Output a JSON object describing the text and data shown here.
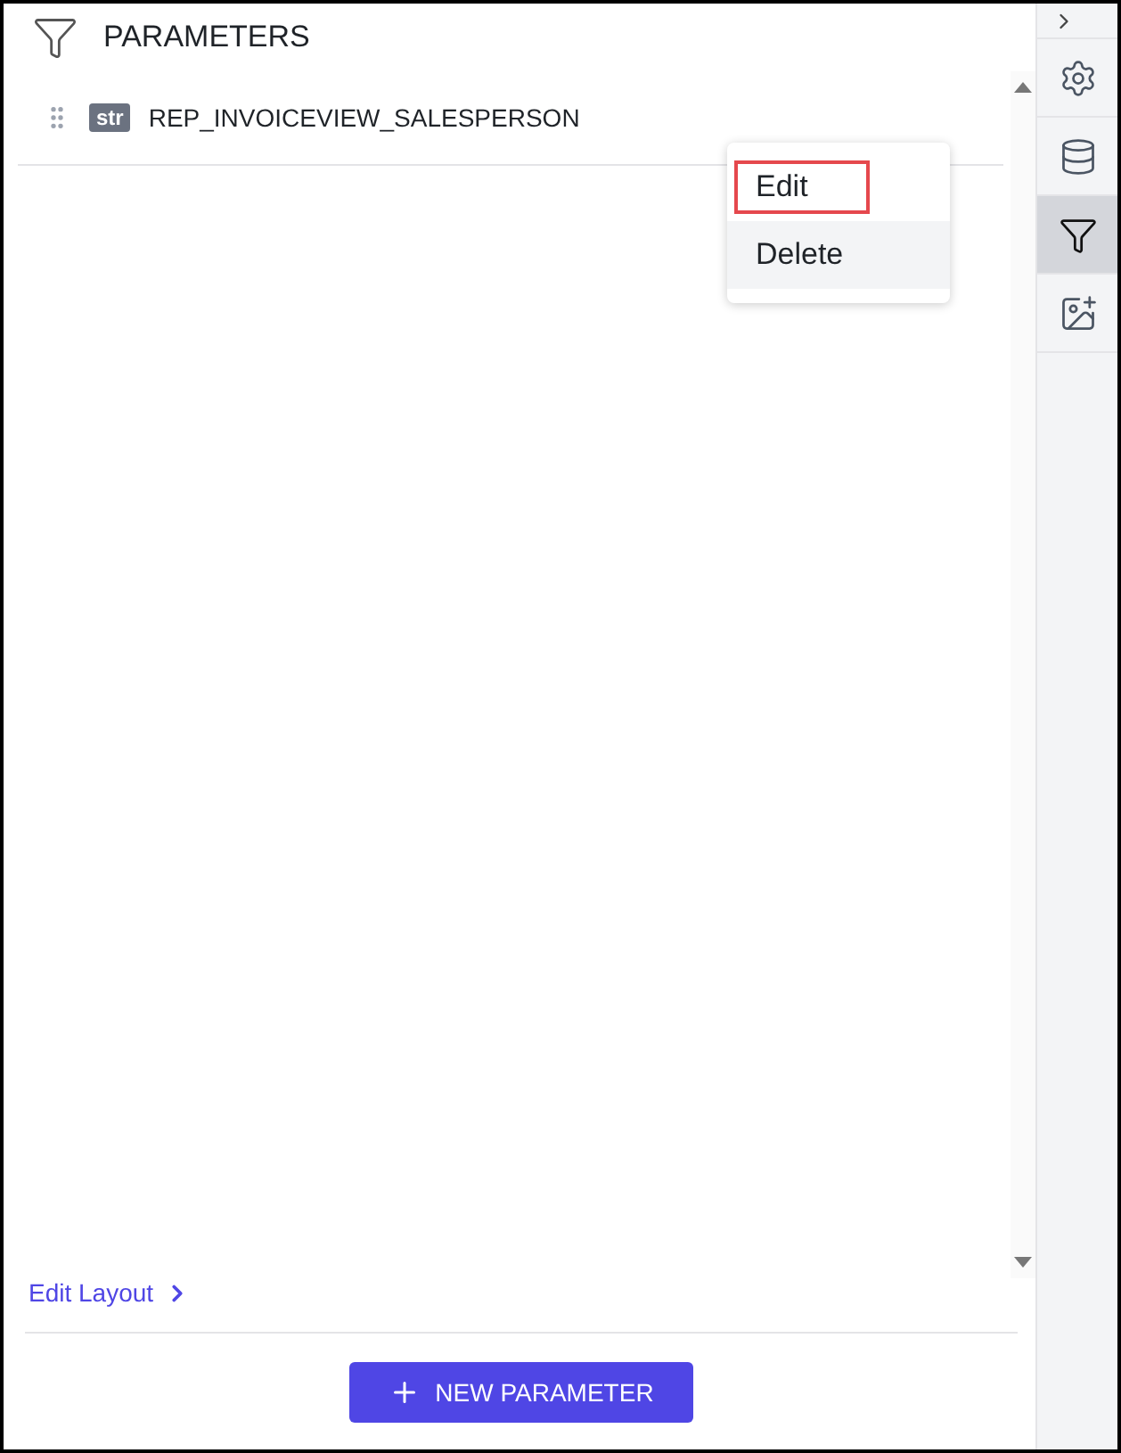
{
  "panel": {
    "title": "PARAMETERS"
  },
  "parameters": [
    {
      "type_tag": "str",
      "name": "REP_INVOICEVIEW_SALESPERSON"
    }
  ],
  "context_menu": [
    {
      "label": "Edit",
      "outlined": true,
      "hovered": false
    },
    {
      "label": "Delete",
      "outlined": false,
      "hovered": true
    }
  ],
  "edit_layout_link": "Edit Layout",
  "new_parameter_button": "NEW PARAMETER",
  "sidebar": [
    {
      "kind": "settings",
      "selected": false
    },
    {
      "kind": "data",
      "selected": false
    },
    {
      "kind": "filter",
      "selected": true
    },
    {
      "kind": "image",
      "selected": false
    }
  ]
}
